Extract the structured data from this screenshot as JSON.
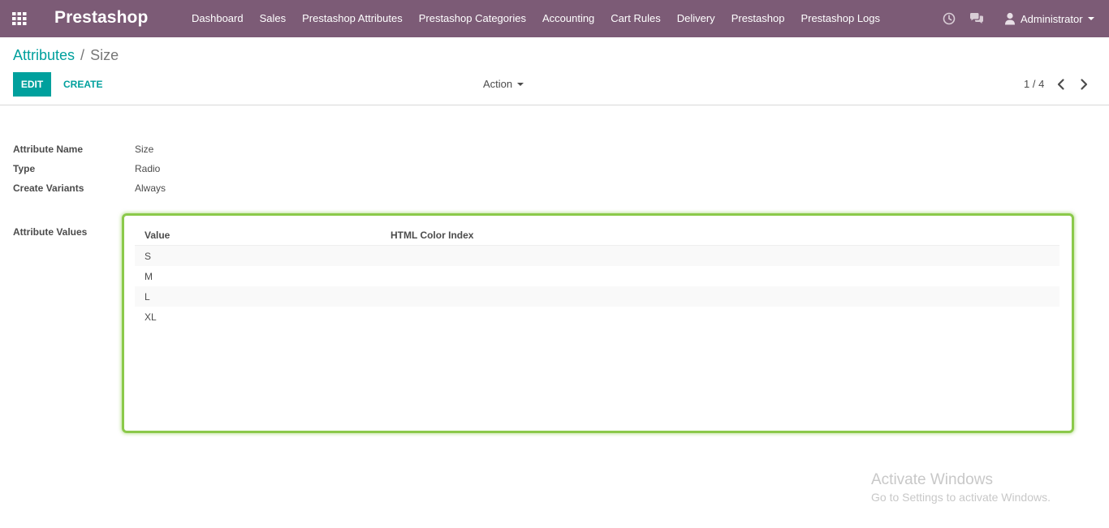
{
  "navbar": {
    "brand": "Prestashop",
    "menu": [
      "Dashboard",
      "Sales",
      "Prestashop Attributes",
      "Prestashop Categories",
      "Accounting",
      "Cart Rules",
      "Delivery",
      "Prestashop",
      "Prestashop Logs"
    ],
    "user": "Administrator",
    "icons": [
      "apps-grid-icon",
      "clock-icon",
      "chat-icon",
      "user-icon"
    ]
  },
  "breadcrumb": {
    "parent": "Attributes",
    "separator": "/",
    "current": "Size"
  },
  "toolbar": {
    "edit_label": "EDIT",
    "create_label": "CREATE",
    "action_label": "Action",
    "pager": "1 / 4"
  },
  "form": {
    "fields": [
      {
        "label": "Attribute Name",
        "value": "Size"
      },
      {
        "label": "Type",
        "value": "Radio"
      },
      {
        "label": "Create Variants",
        "value": "Always"
      }
    ],
    "values_label": "Attribute Values",
    "values_table": {
      "headers": [
        "Value",
        "HTML Color Index"
      ],
      "rows": [
        "S",
        "M",
        "L",
        "XL"
      ]
    }
  },
  "watermark": {
    "line1": "Activate Windows",
    "line2": "Go to Settings to activate Windows."
  },
  "colors": {
    "navbar": "#7c5b76",
    "accent": "#00A09D",
    "highlight": "#8bc94a"
  }
}
